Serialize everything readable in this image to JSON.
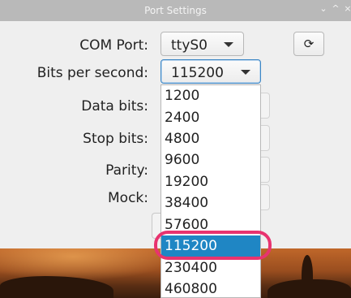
{
  "window": {
    "title": "Port Settings",
    "minimize_glyph": "⌄",
    "maximize_glyph": "^",
    "close_glyph": "×"
  },
  "form": {
    "com_port_label": "COM Port:",
    "com_port_value": "ttyS0",
    "bits_per_second_label": "Bits per second:",
    "bits_per_second_value": "115200",
    "data_bits_label": "Data bits:",
    "stop_bits_label": "Stop bits:",
    "parity_label": "Parity:",
    "mock_label": "Mock:",
    "refresh_glyph": "⟳"
  },
  "dropdown": {
    "options": [
      "1200",
      "2400",
      "4800",
      "9600",
      "19200",
      "38400",
      "57600",
      "115200",
      "230400",
      "460800"
    ],
    "selected": "115200"
  },
  "colors": {
    "selection": "#1f86c4",
    "highlight_ring": "#e8336f"
  }
}
